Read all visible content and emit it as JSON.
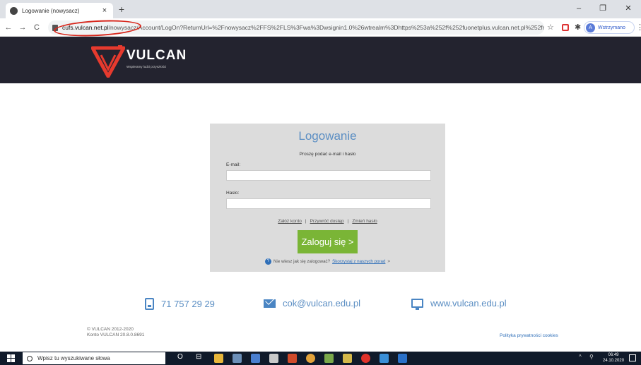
{
  "browser": {
    "tab_title": "Logowanie (nowysacz)",
    "tab_close": "×",
    "new_tab": "+",
    "url_host": "cufs.vulcan.net.pl",
    "url_rest": "/nowysacz/Account/LogOn?ReturnUrl=%2Fnowysacz%2FFS%2FLS%3Fwa%3Dwsignin1.0%26wtrealm%3Dhttps%253a%252f%252fuonetplus.vulcan.net.pl%252fnowy...",
    "profile_initial": "A",
    "profile_label": "Wstrzymano",
    "back": "←",
    "forward": "→",
    "reload": "C",
    "star": "☆",
    "menu": "⋮",
    "minimize": "–",
    "restore": "❐",
    "close": "✕",
    "annotation_color": "#d7261b"
  },
  "site": {
    "logo_text": "VULCAN",
    "logo_tagline": "Wspieramy ludzi przyszłości",
    "brand_color": "#e63a2e",
    "header_bg": "#23232f"
  },
  "login": {
    "title": "Logowanie",
    "subtitle": "Proszę podać e-mail i hasło",
    "email_label": "E-mail:",
    "email_value": "",
    "password_label": "Hasło:",
    "password_value": "",
    "link_create": "Załóż konto",
    "link_restore": "Przywróć dostęp",
    "link_change": "Zmień hasło",
    "link_separator": "|",
    "submit_label": "Zaloguj się >",
    "submit_color": "#7ab536",
    "help_text": "Nie wiesz jak się zalogować?",
    "help_link": "Skorzystaj z naszych porad",
    "help_arrow": ">",
    "help_icon": "?"
  },
  "contacts": {
    "phone": "71 757 29 29",
    "email": "cok@vulcan.edu.pl",
    "website": "www.vulcan.edu.pl"
  },
  "footer": {
    "copyright": "© VULCAN 2012-2020",
    "account_version": "Konto VULCAN 20.8.0.8691",
    "privacy_link": "Polityka prywatności cookies"
  },
  "taskbar": {
    "search_placeholder": "Wpisz tu wyszukiwane słowa",
    "time": "06:49",
    "date": "24.10.2020",
    "tray_up": "^",
    "cortana": "O",
    "task_view": "⊟"
  }
}
